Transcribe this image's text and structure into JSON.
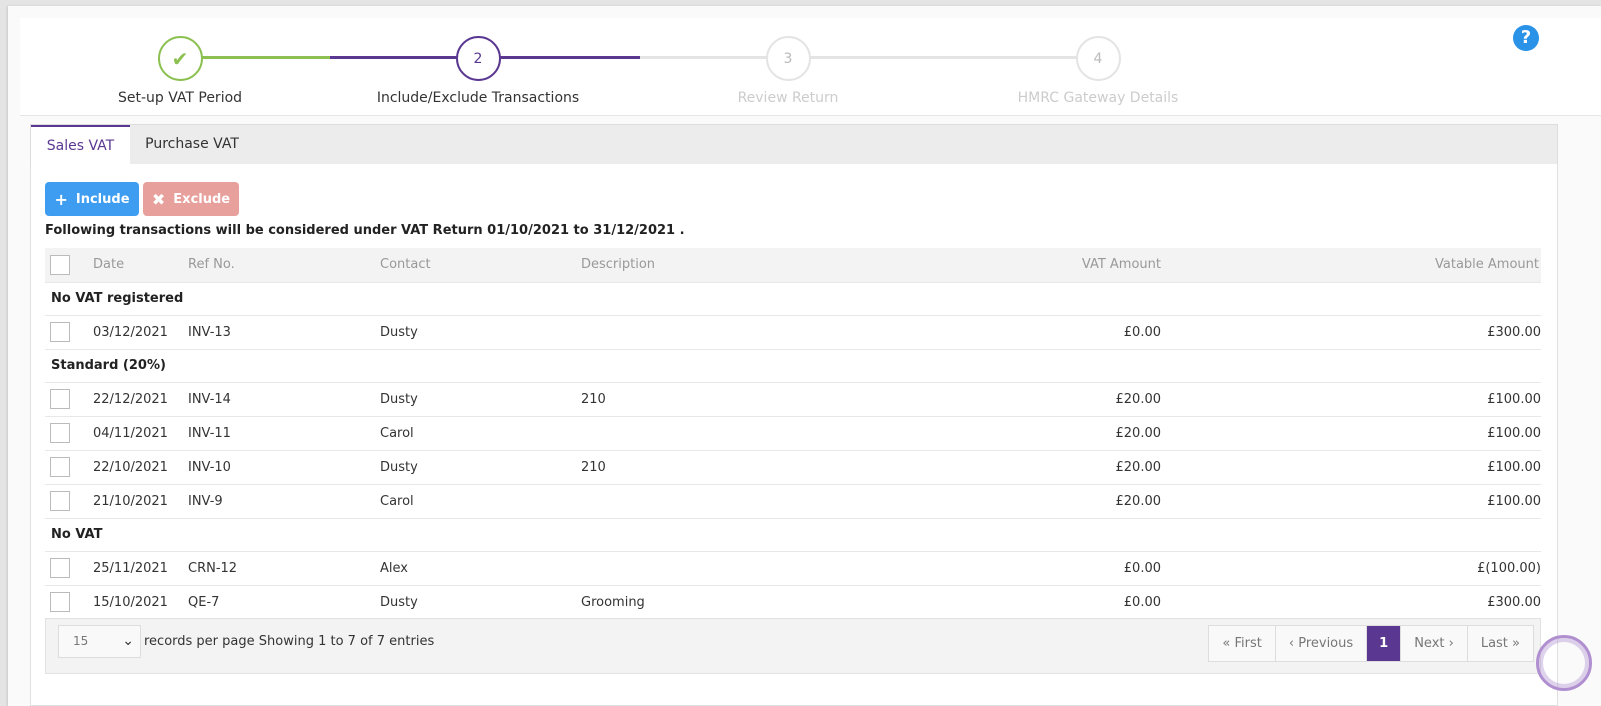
{
  "wizard": {
    "steps": [
      {
        "number": "✔",
        "label": "Set-up VAT Period"
      },
      {
        "number": "2",
        "label": "Include/Exclude Transactions"
      },
      {
        "number": "3",
        "label": "Review Return"
      },
      {
        "number": "4",
        "label": "HMRC Gateway Details"
      }
    ],
    "help": "?"
  },
  "tabs": {
    "sales": "Sales VAT",
    "purchase": "Purchase VAT"
  },
  "toolbar": {
    "include_label": "Include",
    "exclude_label": "Exclude",
    "include_icon": "plus-icon",
    "exclude_icon": "times-icon"
  },
  "summary": "Following transactions will be considered under VAT Return 01/10/2021 to 31/12/2021 .",
  "table": {
    "headers": {
      "date": "Date",
      "ref": "Ref No.",
      "contact": "Contact",
      "description": "Description",
      "vat": "VAT Amount",
      "vatable": "Vatable Amount"
    },
    "groups": [
      {
        "name": "No VAT registered",
        "rows": [
          {
            "date": "03/12/2021",
            "ref": "INV-13",
            "contact": "Dusty",
            "description": "",
            "vat": "£0.00",
            "vatable": "£300.00"
          }
        ]
      },
      {
        "name": "Standard (20%)",
        "rows": [
          {
            "date": "22/12/2021",
            "ref": "INV-14",
            "contact": "Dusty",
            "description": "210",
            "vat": "£20.00",
            "vatable": "£100.00"
          },
          {
            "date": "04/11/2021",
            "ref": "INV-11",
            "contact": "Carol",
            "description": "",
            "vat": "£20.00",
            "vatable": "£100.00"
          },
          {
            "date": "22/10/2021",
            "ref": "INV-10",
            "contact": "Dusty",
            "description": "210",
            "vat": "£20.00",
            "vatable": "£100.00"
          },
          {
            "date": "21/10/2021",
            "ref": "INV-9",
            "contact": "Carol",
            "description": "",
            "vat": "£20.00",
            "vatable": "£100.00"
          }
        ]
      },
      {
        "name": "No VAT",
        "rows": [
          {
            "date": "25/11/2021",
            "ref": "CRN-12",
            "contact": "Alex",
            "description": "",
            "vat": "£0.00",
            "vatable": "£(100.00)"
          },
          {
            "date": "15/10/2021",
            "ref": "QE-7",
            "contact": "Dusty",
            "description": "Grooming",
            "vat": "£0.00",
            "vatable": "£300.00"
          }
        ]
      }
    ]
  },
  "footer": {
    "page_size": "15",
    "records_per_page": "records per page",
    "showing": "Showing 1 to 7 of 7 entries",
    "pager": {
      "first": "« First",
      "previous": "‹ Previous",
      "current": "1",
      "next": "Next ›",
      "last": "Last »"
    }
  },
  "colors": {
    "accent": "#5a3891",
    "done": "#8cc152",
    "include": "#3e9df0",
    "exclude": "#e8a09d"
  }
}
